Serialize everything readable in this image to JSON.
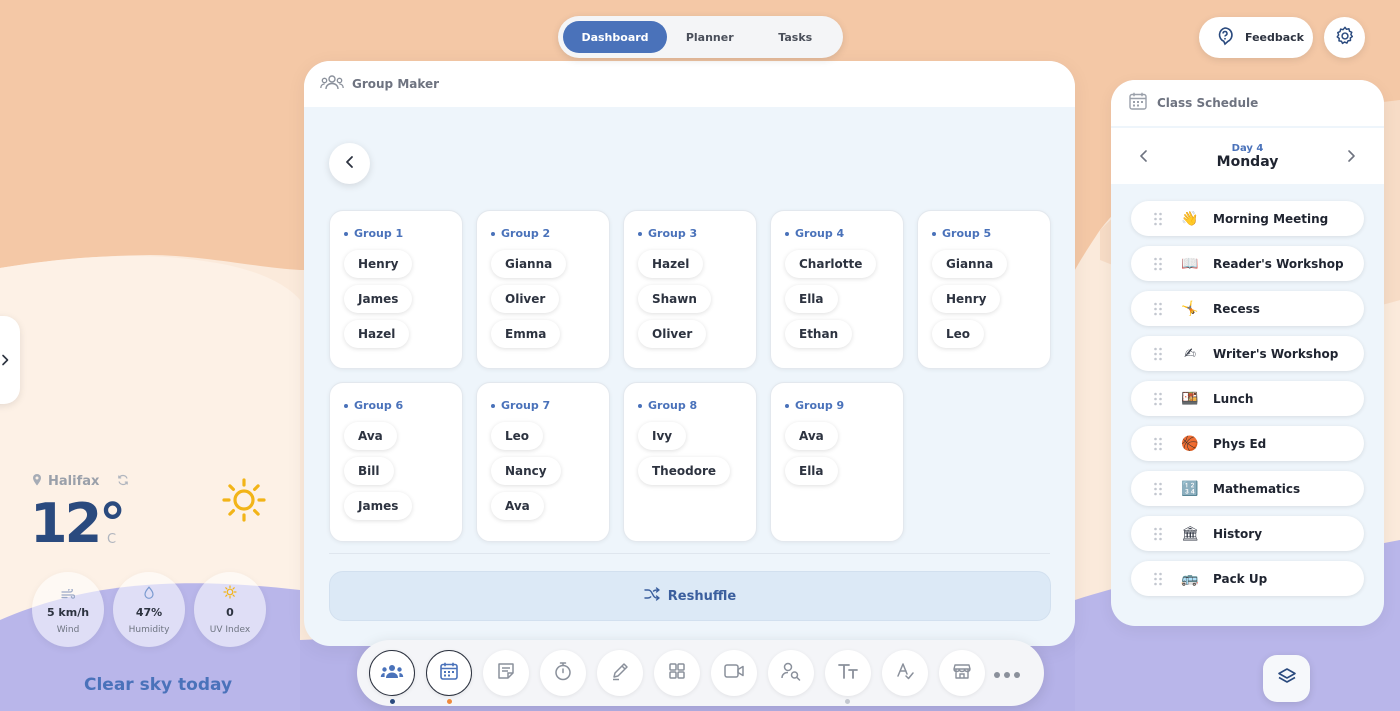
{
  "top_tabs": [
    {
      "label": "Dashboard",
      "active": true
    },
    {
      "label": "Planner",
      "active": false
    },
    {
      "label": "Tasks",
      "active": false
    }
  ],
  "feedback": {
    "label": "Feedback",
    "icon": "question-bubble-icon"
  },
  "settings": {
    "icon": "gear-icon"
  },
  "group_maker": {
    "title": "Group Maker",
    "icon": "people-icon",
    "groups": [
      {
        "name": "Group 1",
        "members": [
          "Henry",
          "James",
          "Hazel"
        ]
      },
      {
        "name": "Group 2",
        "members": [
          "Gianna",
          "Oliver",
          "Emma"
        ]
      },
      {
        "name": "Group 3",
        "members": [
          "Hazel",
          "Shawn",
          "Oliver"
        ]
      },
      {
        "name": "Group 4",
        "members": [
          "Charlotte",
          "Ella",
          "Ethan"
        ]
      },
      {
        "name": "Group 5",
        "members": [
          "Gianna",
          "Henry",
          "Leo"
        ]
      },
      {
        "name": "Group 6",
        "members": [
          "Ava",
          "Bill",
          "James"
        ]
      },
      {
        "name": "Group 7",
        "members": [
          "Leo",
          "Nancy",
          "Ava"
        ]
      },
      {
        "name": "Group 8",
        "members": [
          "Ivy",
          "Theodore"
        ]
      },
      {
        "name": "Group 9",
        "members": [
          "Ava",
          "Ella"
        ]
      }
    ],
    "reshuffle_label": "Reshuffle"
  },
  "schedule": {
    "title": "Class Schedule",
    "day_number": "Day 4",
    "day_name": "Monday",
    "items": [
      {
        "label": "Morning Meeting",
        "emoji": "👋"
      },
      {
        "label": "Reader's Workshop",
        "emoji": "📖"
      },
      {
        "label": "Recess",
        "emoji": "🤸"
      },
      {
        "label": "Writer's Workshop",
        "emoji": "✍"
      },
      {
        "label": "Lunch",
        "emoji": "🍱"
      },
      {
        "label": "Phys Ed",
        "emoji": "🏀"
      },
      {
        "label": "Mathematics",
        "emoji": "🔢"
      },
      {
        "label": "History",
        "emoji": "🏛"
      },
      {
        "label": "Pack Up",
        "emoji": "🚌"
      }
    ]
  },
  "weather": {
    "city": "Halifax",
    "temperature": "12°",
    "unit": "C",
    "stats": [
      {
        "value": "5 km/h",
        "label": "Wind",
        "icon": "wind-icon"
      },
      {
        "value": "47%",
        "label": "Humidity",
        "icon": "droplet-icon"
      },
      {
        "value": "0",
        "label": "UV Index",
        "icon": "sun-small-icon"
      }
    ],
    "summary": "Clear sky today"
  },
  "dock": {
    "items": [
      "group-maker-icon",
      "calendar-icon",
      "notes-icon",
      "timer-icon",
      "draw-icon",
      "grid-icon",
      "video-icon",
      "search-people-icon",
      "text-icon",
      "spelling-icon",
      "store-icon",
      "more-icon"
    ]
  },
  "colors": {
    "accent": "#4a72ba",
    "bg_peach": "#f4c8a6",
    "bg_lavender": "#b5b2e8"
  }
}
